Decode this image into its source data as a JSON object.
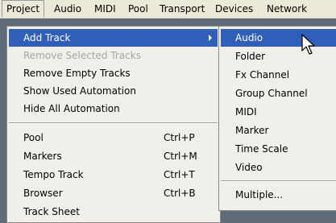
{
  "menubar": {
    "items": [
      "Project",
      "Audio",
      "MIDI",
      "Pool",
      "Transport",
      "Devices",
      "Network"
    ]
  },
  "project_menu": {
    "items": [
      {
        "label": "Add Track",
        "shortcut": ""
      },
      {
        "label": "Remove Selected Tracks",
        "shortcut": ""
      },
      {
        "label": "Remove Empty Tracks",
        "shortcut": ""
      },
      {
        "label": "Show Used Automation",
        "shortcut": ""
      },
      {
        "label": "Hide All Automation",
        "shortcut": ""
      },
      {
        "label": "Pool",
        "shortcut": "Ctrl+P"
      },
      {
        "label": "Markers",
        "shortcut": "Ctrl+M"
      },
      {
        "label": "Tempo Track",
        "shortcut": "Ctrl+T"
      },
      {
        "label": "Browser",
        "shortcut": "Ctrl+B"
      },
      {
        "label": "Track Sheet",
        "shortcut": ""
      }
    ]
  },
  "add_track_submenu": {
    "items": [
      "Audio",
      "Folder",
      "Fx Channel",
      "Group Channel",
      "MIDI",
      "Marker",
      "Time Scale",
      "Video",
      "Multiple..."
    ]
  },
  "colors": {
    "highlight": "#2f5fb8",
    "menu_bg": "#f0efea",
    "disabled_text": "#a6a6a6",
    "background": "#5f6b78"
  },
  "icons": {
    "cursor": "mouse-pointer-icon",
    "submenu_arrow": "submenu-arrow-icon"
  }
}
